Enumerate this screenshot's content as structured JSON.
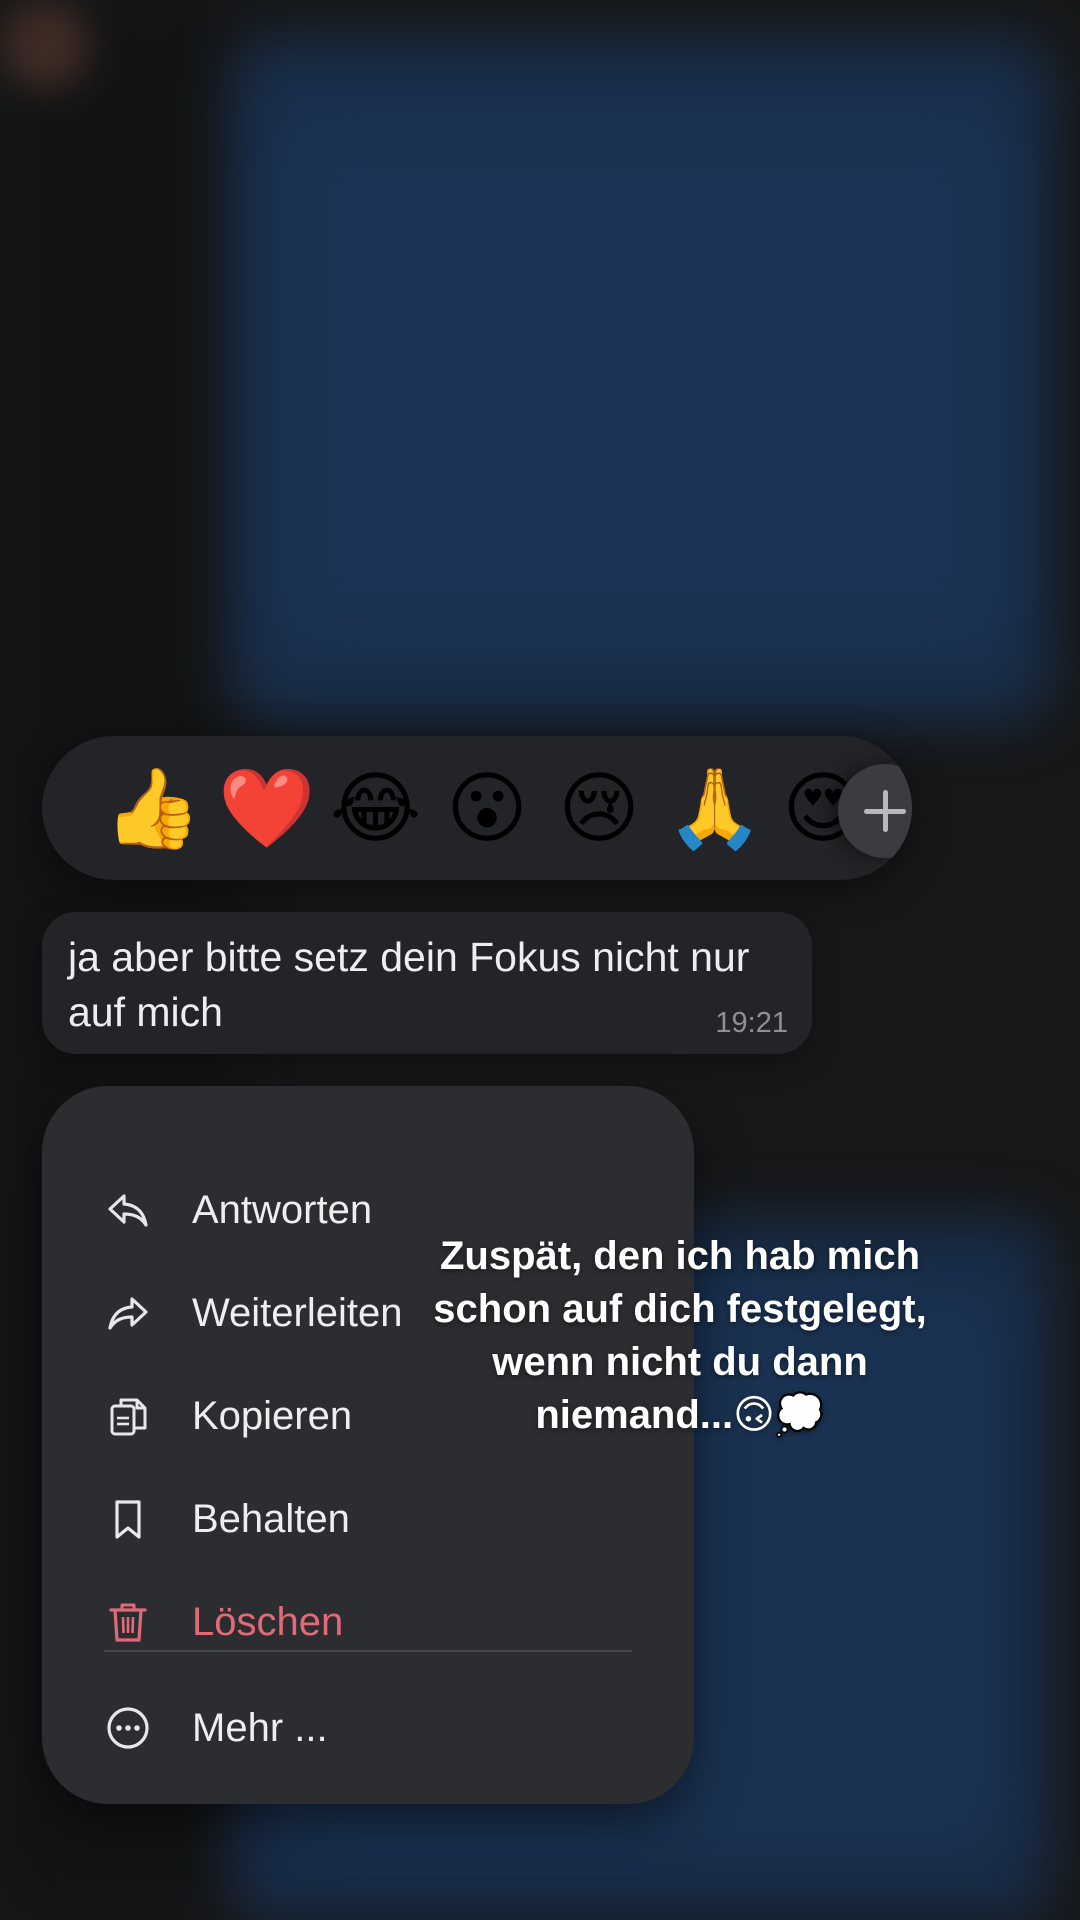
{
  "reactions": {
    "emojis": [
      "👍",
      "❤️",
      "😂",
      "😮",
      "😢",
      "🙏",
      "😍"
    ],
    "add_icon": "plus-icon"
  },
  "message": {
    "text": "ja aber bitte setz dein Fokus nicht nur\nauf mich",
    "time": "19:21"
  },
  "menu": {
    "items": [
      {
        "label": "Antworten",
        "icon": "reply-icon"
      },
      {
        "label": "Weiterleiten",
        "icon": "forward-icon"
      },
      {
        "label": "Kopieren",
        "icon": "copy-icon"
      },
      {
        "label": "Behalten",
        "icon": "bookmark-icon"
      },
      {
        "label": "Löschen",
        "icon": "trash-icon",
        "color": "#e06a78"
      }
    ],
    "more": {
      "label": "Mehr ...",
      "icon": "more-icon"
    }
  },
  "caption": "Zuspät, den ich hab mich schon auf dich festgelegt, wenn nicht du dann niemand...🙃💭"
}
